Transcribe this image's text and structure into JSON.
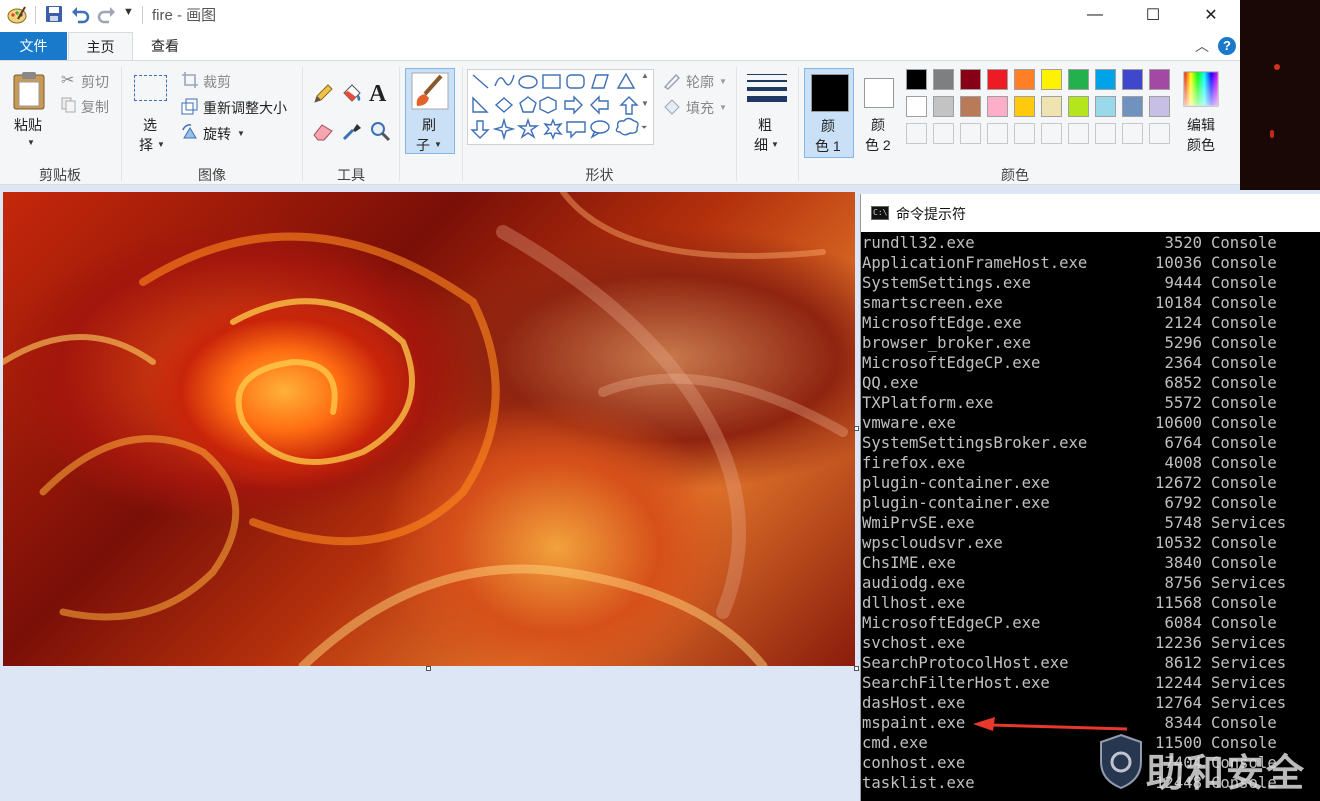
{
  "app": {
    "title": "fire - 画图"
  },
  "window_controls": {
    "minimize": "—",
    "maximize": "☐",
    "close": "✕"
  },
  "tabs": {
    "file": "文件",
    "home": "主页",
    "view": "查看"
  },
  "ribbon": {
    "clipboard": {
      "paste": "粘贴",
      "cut": "剪切",
      "copy": "复制",
      "label": "剪贴板"
    },
    "image": {
      "select_1": "选",
      "select_2": "择",
      "crop": "裁剪",
      "resize": "重新调整大小",
      "rotate": "旋转",
      "label": "图像"
    },
    "tools": {
      "label": "工具"
    },
    "brushes": {
      "line1": "刷",
      "line2": "子"
    },
    "shapes": {
      "outline": "轮廓",
      "fill": "填充",
      "label": "形状"
    },
    "size": {
      "line1": "粗",
      "line2": "细"
    },
    "color1": {
      "line1": "颜",
      "line2": "色 1"
    },
    "color2": {
      "line1": "颜",
      "line2": "色 2"
    },
    "edit_colors": {
      "line1": "编辑",
      "line2": "颜色"
    },
    "colors_label": "颜色",
    "palette": [
      "#000000",
      "#7f7f7f",
      "#880015",
      "#ed1c24",
      "#ff7f27",
      "#fff200",
      "#22b14c",
      "#00a2e8",
      "#3f48cc",
      "#a349a4",
      "#ffffff",
      "#c3c3c3",
      "#b97a57",
      "#ffaec9",
      "#ffc90e",
      "#efe4b0",
      "#b5e61d",
      "#99d9ea",
      "#7092be",
      "#c8bfe7"
    ]
  },
  "cmd": {
    "title": "命令提示符",
    "rows": [
      {
        "name": "rundll32.exe",
        "pid": "3520",
        "session": "Console"
      },
      {
        "name": "ApplicationFrameHost.exe",
        "pid": "10036",
        "session": "Console"
      },
      {
        "name": "SystemSettings.exe",
        "pid": "9444",
        "session": "Console"
      },
      {
        "name": "smartscreen.exe",
        "pid": "10184",
        "session": "Console"
      },
      {
        "name": "MicrosoftEdge.exe",
        "pid": "2124",
        "session": "Console"
      },
      {
        "name": "browser_broker.exe",
        "pid": "5296",
        "session": "Console"
      },
      {
        "name": "MicrosoftEdgeCP.exe",
        "pid": "2364",
        "session": "Console"
      },
      {
        "name": "QQ.exe",
        "pid": "6852",
        "session": "Console"
      },
      {
        "name": "TXPlatform.exe",
        "pid": "5572",
        "session": "Console"
      },
      {
        "name": "vmware.exe",
        "pid": "10600",
        "session": "Console"
      },
      {
        "name": "SystemSettingsBroker.exe",
        "pid": "6764",
        "session": "Console"
      },
      {
        "name": "firefox.exe",
        "pid": "4008",
        "session": "Console"
      },
      {
        "name": "plugin-container.exe",
        "pid": "12672",
        "session": "Console"
      },
      {
        "name": "plugin-container.exe",
        "pid": "6792",
        "session": "Console"
      },
      {
        "name": "WmiPrvSE.exe",
        "pid": "5748",
        "session": "Services"
      },
      {
        "name": "wpscloudsvr.exe",
        "pid": "10532",
        "session": "Console"
      },
      {
        "name": "ChsIME.exe",
        "pid": "3840",
        "session": "Console"
      },
      {
        "name": "audiodg.exe",
        "pid": "8756",
        "session": "Services"
      },
      {
        "name": "dllhost.exe",
        "pid": "11568",
        "session": "Console"
      },
      {
        "name": "MicrosoftEdgeCP.exe",
        "pid": "6084",
        "session": "Console"
      },
      {
        "name": "svchost.exe",
        "pid": "12236",
        "session": "Services"
      },
      {
        "name": "SearchProtocolHost.exe",
        "pid": "8612",
        "session": "Services"
      },
      {
        "name": "SearchFilterHost.exe",
        "pid": "12244",
        "session": "Services"
      },
      {
        "name": "dasHost.exe",
        "pid": "12764",
        "session": "Services"
      },
      {
        "name": "mspaint.exe",
        "pid": "8344",
        "session": "Console"
      },
      {
        "name": "cmd.exe",
        "pid": "11500",
        "session": "Console"
      },
      {
        "name": "conhost.exe",
        "pid": "7404",
        "session": "Console"
      },
      {
        "name": "tasklist.exe",
        "pid": "12448",
        "session": "Console"
      }
    ]
  },
  "watermark": {
    "text": "助和安全"
  },
  "colors": {
    "accent": "#1979ca",
    "arrow": "#e8382c"
  }
}
